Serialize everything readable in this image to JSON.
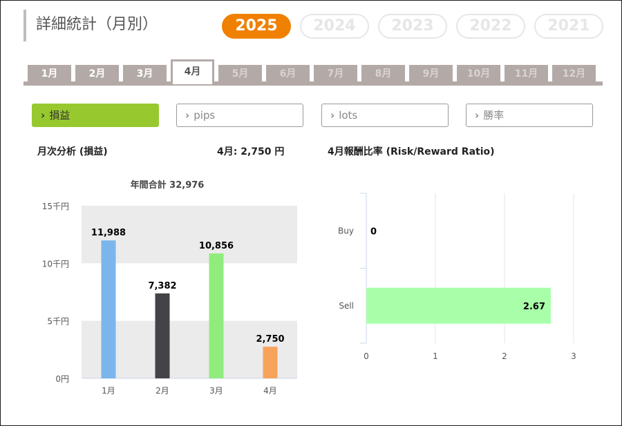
{
  "page": {
    "title": "詳細統計（月別）",
    "years": [
      {
        "label": "2025",
        "active": true
      },
      {
        "label": "2024",
        "active": false
      },
      {
        "label": "2023",
        "active": false
      },
      {
        "label": "2022",
        "active": false
      },
      {
        "label": "2021",
        "active": false
      }
    ],
    "months": [
      {
        "label": "1月",
        "state": "enabled"
      },
      {
        "label": "2月",
        "state": "enabled"
      },
      {
        "label": "3月",
        "state": "enabled"
      },
      {
        "label": "4月",
        "state": "active"
      },
      {
        "label": "5月",
        "state": "disabled"
      },
      {
        "label": "6月",
        "state": "disabled"
      },
      {
        "label": "7月",
        "state": "disabled"
      },
      {
        "label": "8月",
        "state": "disabled"
      },
      {
        "label": "9月",
        "state": "disabled"
      },
      {
        "label": "10月",
        "state": "disabled"
      },
      {
        "label": "11月",
        "state": "disabled"
      },
      {
        "label": "12月",
        "state": "disabled"
      }
    ],
    "metrics": [
      {
        "label": "損益",
        "active": true,
        "icon": "chevron-right-icon"
      },
      {
        "label": "pips",
        "active": false,
        "icon": "chevron-right-icon"
      },
      {
        "label": "lots",
        "active": false,
        "icon": "chevron-right-icon"
      },
      {
        "label": "勝率",
        "active": false,
        "icon": "chevron-right-icon"
      }
    ],
    "monthly_section_title": "月次分析 (損益)",
    "monthly_value": "4月:  2,750 円",
    "ratio_section_title": "4月報酬比率 (Risk/Reward Ratio)",
    "colors": {
      "year_active": "#f08000",
      "metric_active": "#97c92e",
      "tab": "#b3aaa8"
    }
  },
  "chart_data": [
    {
      "type": "bar",
      "title": "年間合計 32,976",
      "categories": [
        "1月",
        "2月",
        "3月",
        "4月"
      ],
      "values": [
        11988,
        7382,
        10856,
        2750
      ],
      "value_labels": [
        "11,988",
        "7,382",
        "10,856",
        "2,750"
      ],
      "colors": [
        "#7cb5ec",
        "#434348",
        "#90ed7d",
        "#f7a35c"
      ],
      "ylim": [
        0,
        15000
      ],
      "yticks": [
        {
          "value": 0,
          "label": "0円"
        },
        {
          "value": 5000,
          "label": "5千円"
        },
        {
          "value": 10000,
          "label": "10千円"
        },
        {
          "value": 15000,
          "label": "15千円"
        }
      ],
      "grid": "alternating bands"
    },
    {
      "type": "bar",
      "orientation": "horizontal",
      "categories": [
        "Buy",
        "Sell"
      ],
      "values": [
        0,
        2.67
      ],
      "value_labels": [
        "0",
        "2.67"
      ],
      "colors": [
        "#a9ffa9",
        "#a9ffa9"
      ],
      "xlim": [
        0,
        3
      ],
      "xticks": [
        "0",
        "1",
        "2",
        "3"
      ],
      "grid": "vertical lines"
    }
  ]
}
